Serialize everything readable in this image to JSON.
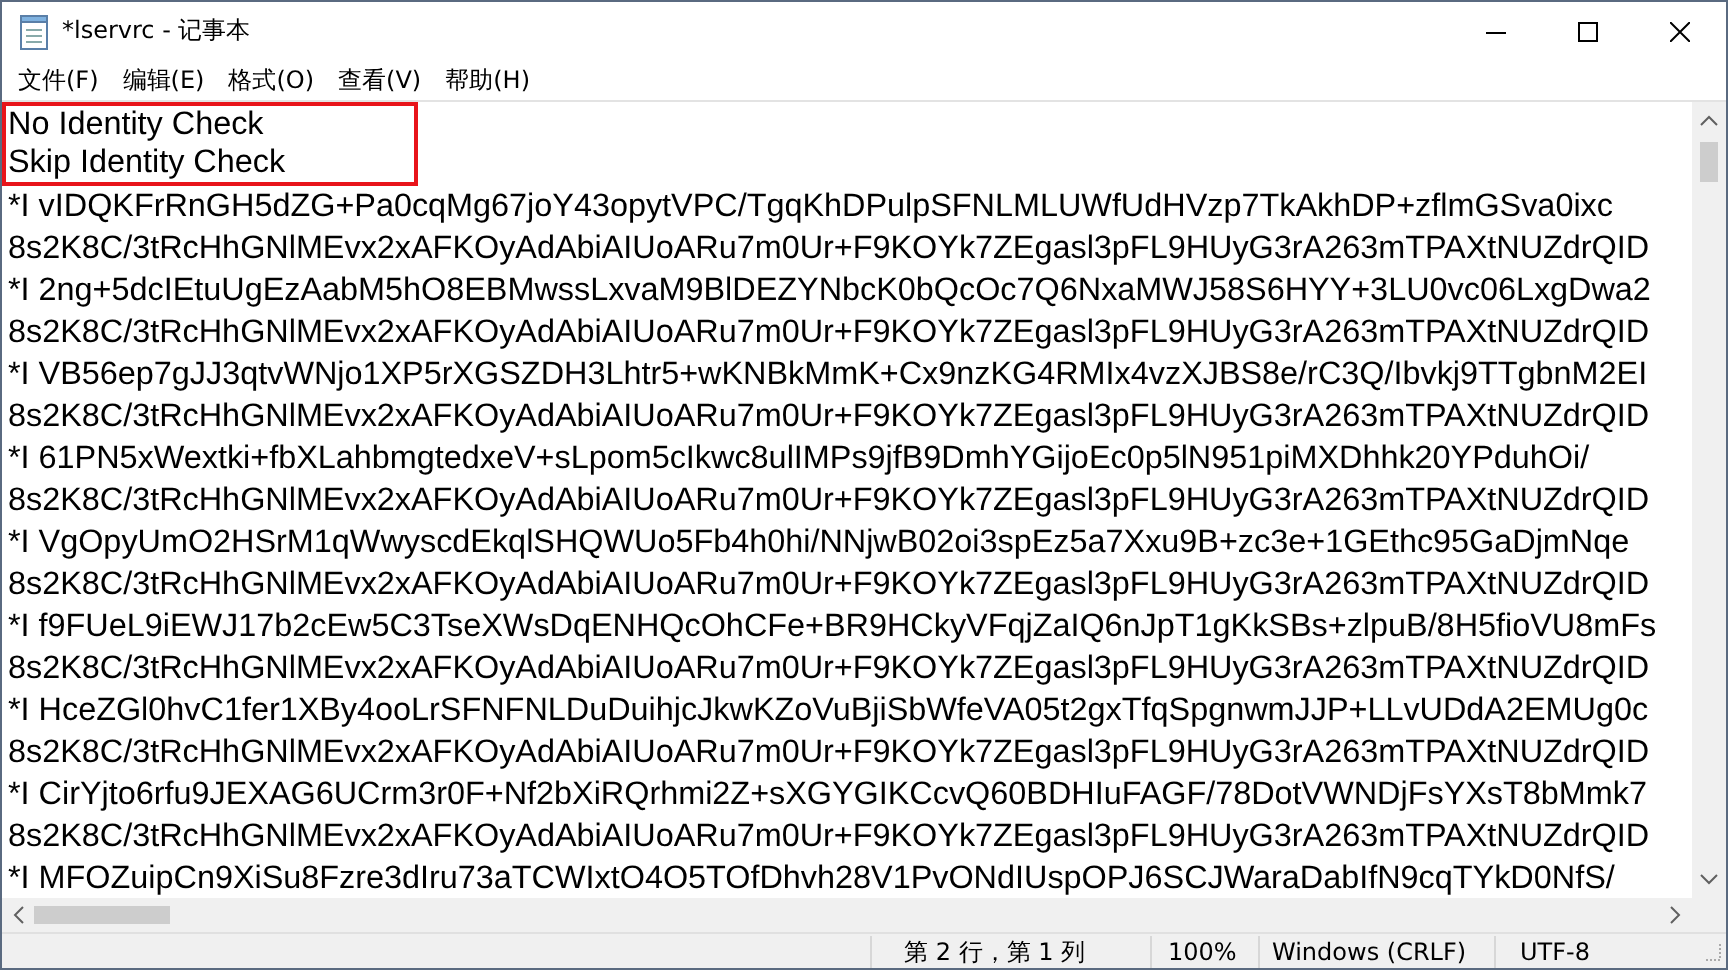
{
  "window": {
    "title": "*lservrc - 记事本"
  },
  "menu": [
    "文件(F)",
    "编辑(E)",
    "格式(O)",
    "查看(V)",
    "帮助(H)"
  ],
  "annotation_box": {
    "lines": [
      "No Identity Check",
      "Skip Identity Check"
    ]
  },
  "lines": [
    "*I vIDQKFrRnGH5dZG+Pa0cqMg67joY43opytVPC/TgqKhDPulpSFNLMLUWfUdHVzp7TkAkhDP+zflmGSva0ixc",
    "8s2K8C/3tRcHhGNlMEvx2xAFKOyAdAbiAIUoARu7m0Ur+F9KOYk7ZEgasl3pFL9HUyG3rA263mTPAXtNUZdrQID",
    "*I 2ng+5dcIEtuUgEzAabM5hO8EBMwssLxvaM9BlDEZYNbcK0bQcOc7Q6NxaMWJ58S6HYY+3LU0vc06LxgDwa2",
    "8s2K8C/3tRcHhGNlMEvx2xAFKOyAdAbiAIUoARu7m0Ur+F9KOYk7ZEgasl3pFL9HUyG3rA263mTPAXtNUZdrQID",
    "*I VB56ep7gJJ3qtvWNjo1XP5rXGSZDH3Lhtr5+wKNBkMmK+Cx9nzKG4RMIx4vzXJBS8e/rC3Q/Ibvkj9TTgbnM2EI",
    "8s2K8C/3tRcHhGNlMEvx2xAFKOyAdAbiAIUoARu7m0Ur+F9KOYk7ZEgasl3pFL9HUyG3rA263mTPAXtNUZdrQID",
    "*I 61PN5xWextki+fbXLahbmgtedxeV+sLpom5cIkwc8ulIMPs9jfB9DmhYGijoEc0p5lN951piMXDhhk20YPduhOi/",
    "8s2K8C/3tRcHhGNlMEvx2xAFKOyAdAbiAIUoARu7m0Ur+F9KOYk7ZEgasl3pFL9HUyG3rA263mTPAXtNUZdrQID",
    "*I VgOpyUmO2HSrM1qWwyscdEkqlSHQWUo5Fb4h0hi/NNjwB02oi3spEz5a7Xxu9B+zc3e+1GEthc95GaDjmNqe",
    "8s2K8C/3tRcHhGNlMEvx2xAFKOyAdAbiAIUoARu7m0Ur+F9KOYk7ZEgasl3pFL9HUyG3rA263mTPAXtNUZdrQID",
    "*I f9FUeL9iEWJ17b2cEw5C3TseXWsDqENHQcOhCFe+BR9HCkyVFqjZaIQ6nJpT1gKkSBs+zlpuB/8H5fioVU8mFs",
    "8s2K8C/3tRcHhGNlMEvx2xAFKOyAdAbiAIUoARu7m0Ur+F9KOYk7ZEgasl3pFL9HUyG3rA263mTPAXtNUZdrQID",
    "*I HceZGl0hvC1fer1XBy4ooLrSFNFNLDuDuihjcJkwKZoVuBjiSbWfeVA05t2gxTfqSpgnwmJJP+LLvUDdA2EMUg0c",
    "8s2K8C/3tRcHhGNlMEvx2xAFKOyAdAbiAIUoARu7m0Ur+F9KOYk7ZEgasl3pFL9HUyG3rA263mTPAXtNUZdrQID",
    "*I CirYjto6rfu9JEXAG6UCrm3r0F+Nf2bXiRQrhmi2Z+sXGYGIKCcvQ60BDHIuFAGF/78DotVWNDjFsYXsT8bMmk7",
    "8s2K8C/3tRcHhGNlMEvx2xAFKOyAdAbiAIUoARu7m0Ur+F9KOYk7ZEgasl3pFL9HUyG3rA263mTPAXtNUZdrQID",
    "*I MFOZuipCn9XiSu8Fzre3dIru73aTCWIxtO4O5TOfDhvh28V1PvONdIUspOPJ6SCJWaraDabIfN9cqTYkD0NfS/"
  ],
  "status_bar": [
    "第 2 行，第 1 列",
    "100%",
    "Windows (CRLF)",
    "UTF-8"
  ]
}
